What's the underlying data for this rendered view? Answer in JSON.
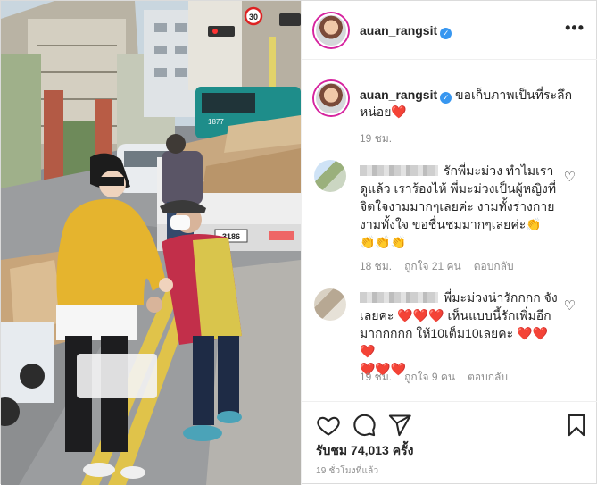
{
  "post": {
    "username": "auan_rangsit",
    "more_icon": "more-horizontal-icon"
  },
  "caption": {
    "username": "auan_rangsit",
    "text": "ขอเก็บภาพเป็นที่ระลึก หน่อย",
    "heart": "❤️",
    "time": "19 ชม."
  },
  "comments": [
    {
      "text": "รักพี่มะม่วง ทำไมเราดูแล้ว เราร้องไห้ พี่มะม่วงเป็นผู้หญิงที่จิตใจงามมากๆเลยค่ะ งามทั้งร่างกาย งามทั้งใจ ขอชื่นชมมากๆเลยค่ะ👏",
      "emoji_line": "👏👏👏",
      "time": "18 ชม.",
      "likes": "ถูกใจ 21 คน",
      "reply": "ตอบกลับ"
    },
    {
      "text": "พี่มะม่วงน่ารักกกก จังเลยคะ ❤️❤️❤️ เห็นแบบนี้รักเพิ่มอีกมากกกกก ให้10เต็ม10เลยคะ ❤️❤️❤️",
      "emoji_line": "❤️❤️❤️",
      "time": "19 ชม.",
      "likes": "ถูกใจ 9 คน",
      "reply": "ตอบกลับ"
    }
  ],
  "footer": {
    "likes": "รับชม 74,013 ครั้ง",
    "ago": "19 ชั่วโมงที่แล้ว"
  },
  "photo": {
    "signs": {
      "speed_limit": "30",
      "bus_number": "1877"
    },
    "plate": "3186",
    "description_icon": "street-photo"
  }
}
